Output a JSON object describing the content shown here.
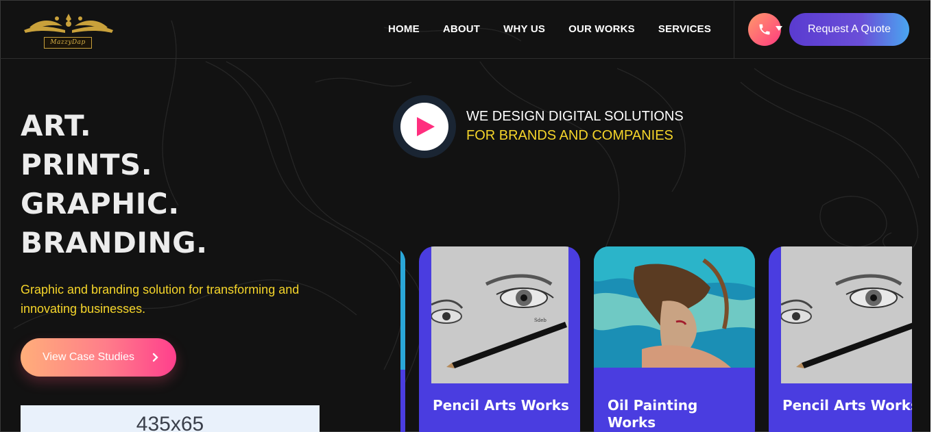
{
  "header": {
    "logo_text": "MazzyDap",
    "nav": [
      "HOME",
      "ABOUT",
      "WHY US",
      "OUR WORKS",
      "SERVICES"
    ],
    "quote_label": "Request A Quote"
  },
  "hero": {
    "lines": [
      "ART.",
      "PRINTS.",
      "GRAPHIC.",
      "BRANDING."
    ],
    "subtitle": "Graphic and branding solution for transforming and innovating businesses.",
    "cta_label": "View Case Studies",
    "ad_text": "435x65"
  },
  "tagline": {
    "line1": "WE DESIGN DIGITAL SOLUTIONS",
    "line2": "FOR BRANDS AND COMPANIES"
  },
  "cards": [
    {
      "title": "Pencil Arts Works",
      "image": "pencil-eye-drawing"
    },
    {
      "title": "Oil Painting Works",
      "image": "underwater-woman-painting"
    },
    {
      "title": "Pencil Arts Works",
      "image": "pencil-eye-drawing"
    }
  ],
  "colors": {
    "background": "#121212",
    "accent_yellow": "#f5d52a",
    "card_purple": "#4a3de0",
    "play_pink": "#ff2e7e",
    "logo_gold": "#c9a13b"
  }
}
